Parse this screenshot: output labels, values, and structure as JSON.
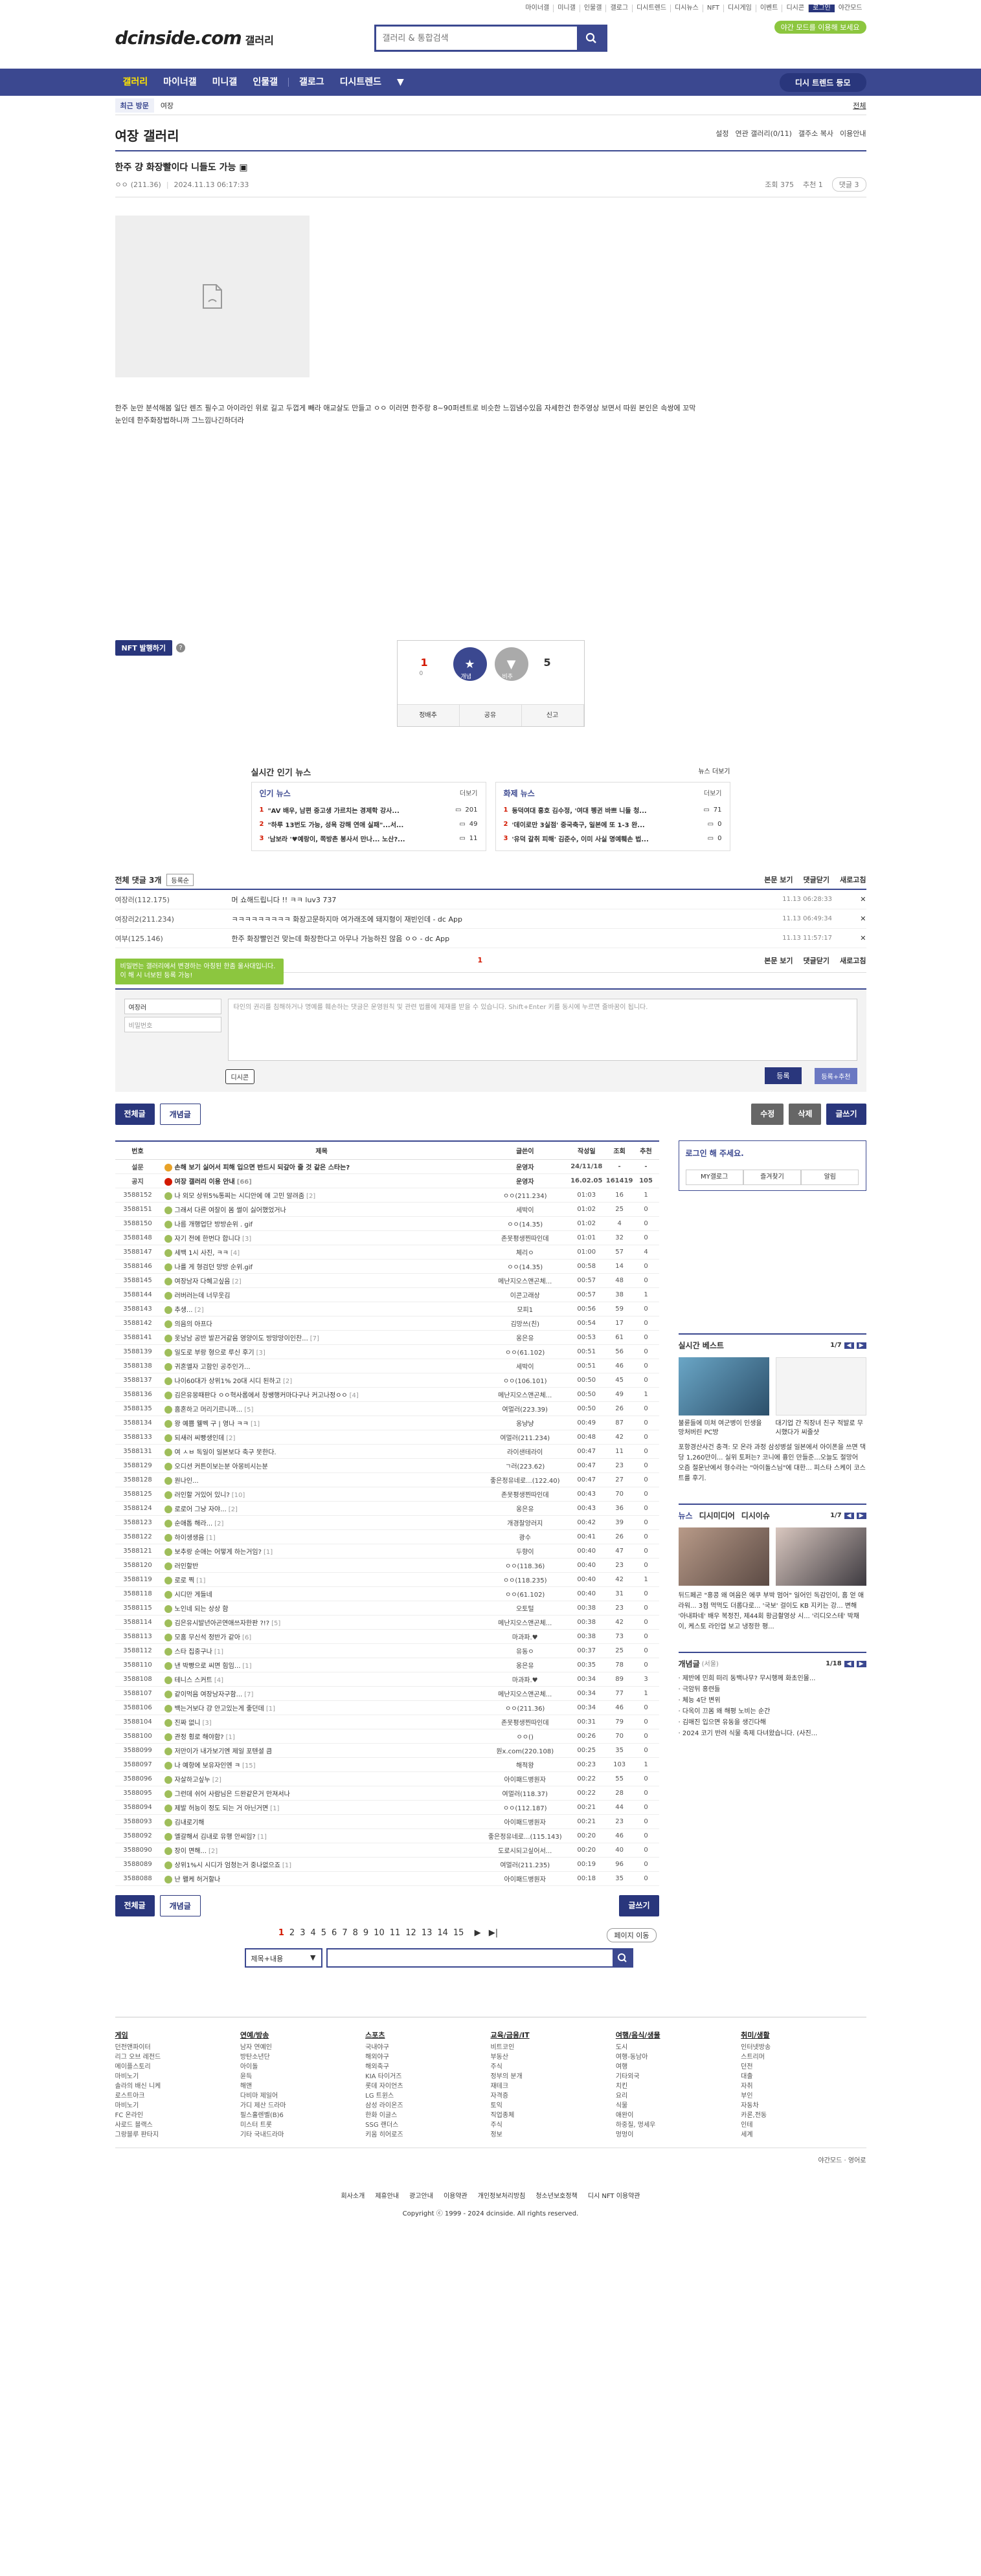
{
  "util_links": [
    "마이너갤",
    "미니갤",
    "인물갤",
    "갤로그",
    "디시트렌드",
    "디시뉴스",
    "NFT",
    "디시게임",
    "이벤트",
    "디시콘",
    "로그인",
    "야간모드"
  ],
  "logo": {
    "brand": "dcinside.com",
    "gallery": "갤러리"
  },
  "search": {
    "placeholder": "갤러리 & 통합검색"
  },
  "promo": "야간 모드를 이용해 보세요",
  "gnb": {
    "items": [
      "갤러리",
      "마이너갤",
      "미니갤",
      "인물갤",
      "갤로그",
      "디시트렌드"
    ],
    "more": "▼",
    "visit": "디시 트렌드 등모"
  },
  "history": {
    "label": "최근 방문",
    "item": "여장",
    "all": "전체"
  },
  "gallery": {
    "title": "여장 갤러리",
    "tools": [
      "설정",
      "연관 갤러리(0/11)",
      "갤주소 복사",
      "이용안내"
    ]
  },
  "post": {
    "title": "한주 걍 화장빨이다 니들도 가능",
    "author": "ㅇㅇ",
    "ip": "(211.36)",
    "date": "2024.11.13 06:17:33",
    "views": "조회 375",
    "recommend": "추천 1",
    "comments": "댓글 3",
    "body": "한주 눈만 분석해봄 일단 렌즈 필수고 아이라인 위로 길고 두껍게 빼라 애교살도 만들고 ㅇㅇ 이러면 한주랑 8~90퍼센트로 비슷한 느낌냄수있음 자세한건 한주영상 보면서 따원 본인은 속쌍에 꼬막눈인데 한주화장법하니까 그느낌나긴하더라"
  },
  "nft_button": "NFT 발행하기",
  "recom": {
    "up": 1,
    "up_label": "개념",
    "up_fix": "0",
    "down": 5,
    "down_label": "비추",
    "share": "공유",
    "report": "신고",
    "scrap": "정배추"
  },
  "news": {
    "title": "실시간 인기 뉴스",
    "more": "뉴스 더보기",
    "left": {
      "header": "인기 뉴스",
      "more": "더보기",
      "items": [
        {
          "n": "1",
          "t": "\"AV 배우, 남편 중고생 가르치는 경제학 강사...",
          "c": "201"
        },
        {
          "n": "2",
          "t": "\"하루 13번도 가능, 성욕 강해 연애 실패\"...서...",
          "c": "49"
        },
        {
          "n": "3",
          "t": "'남보라 '♥예랑이, 쪽방촌 봉사서 만나... 노산?...",
          "c": "11"
        }
      ]
    },
    "right": {
      "header": "화제 뉴스",
      "more": "더보기",
      "items": [
        {
          "n": "1",
          "t": "동덕여대 홍호 김수정, '여대 펭귄 바쁘 니들 청...",
          "c": "71"
        },
        {
          "n": "2",
          "t": "'데이로만 3실점' 중국축구, 일본에 또 1-3 완...",
          "c": "0"
        },
        {
          "n": "3",
          "t": "'유덕 갈취 피해' 김준수, 이미 사실 명예훼손 법...",
          "c": "0"
        }
      ]
    }
  },
  "comments": {
    "header": "전체 댓글 3개",
    "sort": "등록순",
    "view": "본문 보기",
    "fold": "댓글닫기",
    "refresh": "새로고침",
    "rows": [
      {
        "nick": "여장러",
        "ip": "(112.175)",
        "txt": "머 쇼해드립니다 !! ㅋㅋ luv3 737",
        "dt": "11.13 06:28:33"
      },
      {
        "nick": "여장러2",
        "ip": "(211.234)",
        "txt": "ㅋㅋㅋㅋㅋㅋㅋㅋㅋ 화장고문하지마 여가래조에 돼지형이 재빈인데 - dc App",
        "dt": "11.13 06:49:34"
      },
      {
        "nick": "여부",
        "ip": "(125.146)",
        "txt": "한주 화장빨인건 맞는데 화장한다고 아무나 가능하진 않음 ㅇㅇ - dc App",
        "dt": "11.13 11:57:17"
      }
    ],
    "page": "1"
  },
  "write": {
    "tip": "비밀번는 갤러리에서 변경하는 아칭된 한좀 울사대입니다. 이 해 시 너보된 등록 가능!",
    "nick": "여장러",
    "pw": "비밀번호",
    "placeholder": "타인의 권리를 침해하거나 명예를 훼손하는 댓글은 운영원칙 및 관련 법률에 제재를 받을 수 있습니다. Shift+Enter 키를 동시에 누르면 줄바꿈이 됩니다.",
    "dccon": "디시콘",
    "submit": "등록",
    "submit2": "등록+추천"
  },
  "post_buttons": {
    "all": "전체글",
    "concept": "개념글",
    "edit": "수정",
    "del": "삭제",
    "write": "글쓰기"
  },
  "list": {
    "headers": [
      "번호",
      "제목",
      "글쓴이",
      "작성일",
      "조회",
      "추천"
    ],
    "notices": [
      {
        "num": "설문",
        "sub": "손해 보기 싫어서 피해 입으면 반드시 되갚아 줄 것 같은 스타는?",
        "wr": "운영자",
        "d": "24/11/18",
        "c": "-",
        "r": "-",
        "ico": "survey"
      },
      {
        "num": "공지",
        "sub": "여장 갤러리 이용 안내",
        "cm": "[66]",
        "wr": "운영자",
        "d": "16.02.05",
        "c": "161419",
        "r": "105",
        "ico": "notice"
      }
    ],
    "rows": [
      {
        "num": "3588152",
        "sub": "나 외모 상위5%통찌는 시디안에 얘 고민 알려줌",
        "cm": "[2]",
        "wr": "ㅇㅇ(211.234)",
        "d": "01:03",
        "c": "16",
        "r": "1"
      },
      {
        "num": "3588151",
        "sub": "그래서 다른 여잘이 몸 썰이 싫어했었거나",
        "cm": "",
        "wr": "세박이",
        "d": "01:02",
        "c": "25",
        "r": "0"
      },
      {
        "num": "3588150",
        "sub": "나름 개행업단 방방순위 . gif",
        "cm": "",
        "wr": "ㅇㅇ(14.35)",
        "d": "01:02",
        "c": "4",
        "r": "0"
      },
      {
        "num": "3588148",
        "sub": "자기 전에 한번다 합니다",
        "cm": "[3]",
        "wr": "존못평생찐따인데",
        "d": "01:01",
        "c": "32",
        "r": "0"
      },
      {
        "num": "3588147",
        "sub": "세백 1시 사진, ㅋㅋ",
        "cm": "[4]",
        "wr": "체리ㅇ",
        "d": "01:00",
        "c": "57",
        "r": "4"
      },
      {
        "num": "3588146",
        "sub": "나를 게 형검던 망방 순위.gif",
        "cm": "",
        "wr": "ㅇㅇ(14.35)",
        "d": "00:58",
        "c": "14",
        "r": "0"
      },
      {
        "num": "3588145",
        "sub": "여장남자 다혜고싶음",
        "cm": "[2]",
        "wr": "메난지오스앤곤체...",
        "d": "00:57",
        "c": "48",
        "r": "0"
      },
      {
        "num": "3588144",
        "sub": "러버러는데 너무웃김",
        "cm": "",
        "wr": "이콘고래상",
        "d": "00:57",
        "c": "38",
        "r": "1"
      },
      {
        "num": "3588143",
        "sub": "추생...",
        "cm": "[2]",
        "wr": "모피1",
        "d": "00:56",
        "c": "59",
        "r": "0"
      },
      {
        "num": "3588142",
        "sub": "의음의 아프다",
        "cm": "",
        "wr": "김망쓰(친)",
        "d": "00:54",
        "c": "17",
        "r": "0"
      },
      {
        "num": "3588141",
        "sub": "옷남남 공반 발끈거같음 영양이도 방망망이인찬...",
        "cm": "[7]",
        "wr": "옹은유",
        "d": "00:53",
        "c": "61",
        "r": "0"
      },
      {
        "num": "3588139",
        "sub": "일도로 부랑 형으로 루신 후기",
        "cm": "[3]",
        "wr": "ㅇㅇ(61.102)",
        "d": "00:51",
        "c": "56",
        "r": "0"
      },
      {
        "num": "3588138",
        "sub": "귀혼엘자 고함인 공주인가...",
        "cm": "",
        "wr": "세박이",
        "d": "00:51",
        "c": "46",
        "r": "0"
      },
      {
        "num": "3588137",
        "sub": "나이60대가 상위1% 20대 시디 된하고",
        "cm": "[2]",
        "wr": "ㅇㅇ(106.101)",
        "d": "00:50",
        "c": "45",
        "r": "0"
      },
      {
        "num": "3588136",
        "sub": "김은유몽때판다 ㅇㅇ혁사롭에서 창쌩행커마다구나 커고나정ㅇㅇ",
        "cm": "[4]",
        "wr": "메난지오스앤곤체...",
        "d": "00:50",
        "c": "49",
        "r": "1"
      },
      {
        "num": "3588135",
        "sub": "홈혼하고 머리기르니까...",
        "cm": "[5]",
        "wr": "여멀러(223.39)",
        "d": "00:50",
        "c": "26",
        "r": "0"
      },
      {
        "num": "3588134",
        "sub": "왕 예쁨 웰벡 구 | 영나 ㅋㅋ",
        "cm": "[1]",
        "wr": "옹냥냥",
        "d": "00:49",
        "c": "87",
        "r": "0"
      },
      {
        "num": "3588133",
        "sub": "되새러 씨빵생인데",
        "cm": "[2]",
        "wr": "여멀러(211.234)",
        "d": "00:48",
        "c": "42",
        "r": "0"
      },
      {
        "num": "3588131",
        "sub": "여 ㅅㅂ 독일이 일본보다 축구 못한다.",
        "cm": "",
        "wr": "라이샌테라이",
        "d": "00:47",
        "c": "11",
        "r": "0"
      },
      {
        "num": "3588129",
        "sub": "오디션 커튼이보는분 아몽비시는분",
        "cm": "",
        "wr": "ㄱ러(223.62)",
        "d": "00:47",
        "c": "23",
        "r": "0"
      },
      {
        "num": "3588128",
        "sub": "원나인...",
        "cm": "",
        "wr": "좋은정유네로...(122.40)",
        "d": "00:47",
        "c": "27",
        "r": "0"
      },
      {
        "num": "3588125",
        "sub": "러인할 거있어 있니?",
        "cm": "[10]",
        "wr": "존못평생찐따인데",
        "d": "00:43",
        "c": "70",
        "r": "0"
      },
      {
        "num": "3588124",
        "sub": "로로어 그냥 자야...",
        "cm": "[2]",
        "wr": "옹은유",
        "d": "00:43",
        "c": "36",
        "r": "0"
      },
      {
        "num": "3588123",
        "sub": "순애톱 해라...",
        "cm": "[2]",
        "wr": "개경찰양러지",
        "d": "00:42",
        "c": "39",
        "r": "0"
      },
      {
        "num": "3588122",
        "sub": "하이생생음",
        "cm": "[1]",
        "wr": "광수",
        "d": "00:41",
        "c": "26",
        "r": "0"
      },
      {
        "num": "3588121",
        "sub": "보추랑 순애는 어떻게 하는거임?",
        "cm": "[1]",
        "wr": "두향이",
        "d": "00:40",
        "c": "47",
        "r": "0"
      },
      {
        "num": "3588120",
        "sub": "러인할반",
        "cm": "",
        "wr": "ㅇㅇ(118.36)",
        "d": "00:40",
        "c": "23",
        "r": "0"
      },
      {
        "num": "3588119",
        "sub": "로로 찍",
        "cm": "[1]",
        "wr": "ㅇㅇ(118.235)",
        "d": "00:40",
        "c": "42",
        "r": "1"
      },
      {
        "num": "3588118",
        "sub": "시디만 게들네",
        "cm": "",
        "wr": "ㅇㅇ(61.102)",
        "d": "00:40",
        "c": "31",
        "r": "0"
      },
      {
        "num": "3588115",
        "sub": "노인네 되는 상상 함",
        "cm": "",
        "wr": "오토털",
        "d": "00:38",
        "c": "23",
        "r": "0"
      },
      {
        "num": "3588114",
        "sub": "김은유시발년아곤연애쓰자한판 ?!?",
        "cm": "[5]",
        "wr": "메난지오스앤곤체...",
        "d": "00:38",
        "c": "42",
        "r": "0"
      },
      {
        "num": "3588113",
        "sub": "모홈 무신석 정반가 같아",
        "cm": "[6]",
        "wr": "마과파.♥",
        "d": "00:38",
        "c": "73",
        "r": "0"
      },
      {
        "num": "3588112",
        "sub": "스타 집중구나",
        "cm": "[1]",
        "wr": "유동ㅇ",
        "d": "00:37",
        "c": "25",
        "r": "0"
      },
      {
        "num": "3588110",
        "sub": "낸 박빵으로 씨면 힘임...",
        "cm": "[1]",
        "wr": "옹은유",
        "d": "00:35",
        "c": "78",
        "r": "0"
      },
      {
        "num": "3588108",
        "sub": "테니스 스커트",
        "cm": "[4]",
        "wr": "마과파.♥",
        "d": "00:34",
        "c": "89",
        "r": "3"
      },
      {
        "num": "3588107",
        "sub": "같이먹음 여장남자구함...",
        "cm": "[7]",
        "wr": "메난지오스앤곤체...",
        "d": "00:34",
        "c": "77",
        "r": "1"
      },
      {
        "num": "3588106",
        "sub": "백는거보다 걍 안고있는게 좋던데",
        "cm": "[1]",
        "wr": "ㅇㅇ(211.36)",
        "d": "00:34",
        "c": "46",
        "r": "0"
      },
      {
        "num": "3588104",
        "sub": "진짜 없니",
        "cm": "[3]",
        "wr": "존못평생찐따인데",
        "d": "00:31",
        "c": "79",
        "r": "0"
      },
      {
        "num": "3588100",
        "sub": "관정 횡로 해야함?",
        "cm": "[1]",
        "wr": "ㅇㅇ()",
        "d": "00:26",
        "c": "70",
        "r": "0"
      },
      {
        "num": "3588099",
        "sub": "저만이가 내가보기엔 제일 포텐셜 큼",
        "cm": "",
        "wr": "원x.com(220.108)",
        "d": "00:25",
        "c": "35",
        "r": "0"
      },
      {
        "num": "3588097",
        "sub": "나 예항에 보유자인엔 ㅋ",
        "cm": "[15]",
        "wr": "해적왕",
        "d": "00:23",
        "c": "103",
        "r": "1"
      },
      {
        "num": "3588096",
        "sub": "자살하고싶누",
        "cm": "[2]",
        "wr": "아이패드병원자",
        "d": "00:22",
        "c": "55",
        "r": "0"
      },
      {
        "num": "3588095",
        "sub": "그런데 쉬어 사람님은 드완같은거 만져서나",
        "cm": "",
        "wr": "여멀러(118.37)",
        "d": "00:22",
        "c": "28",
        "r": "0"
      },
      {
        "num": "3588094",
        "sub": "제발 허능이 정도 되는 거 아닌거면",
        "cm": "[1]",
        "wr": "ㅇㅇ(112.187)",
        "d": "00:21",
        "c": "44",
        "r": "0"
      },
      {
        "num": "3588093",
        "sub": "김내로기해",
        "cm": "",
        "wr": "아이패드병원자",
        "d": "00:21",
        "c": "23",
        "r": "0"
      },
      {
        "num": "3588092",
        "sub": "엘갈해서 김내로 유행 안씨임?",
        "cm": "[1]",
        "wr": "좋은정유네로...(115.143)",
        "d": "00:20",
        "c": "46",
        "r": "0"
      },
      {
        "num": "3588090",
        "sub": "장이 면해...",
        "cm": "[2]",
        "wr": "도로시되고싶어서...",
        "d": "00:20",
        "c": "40",
        "r": "0"
      },
      {
        "num": "3588089",
        "sub": "상위1%시 시디가 엄청는거 중나없으죠",
        "cm": "[1]",
        "wr": "여멀러(211.235)",
        "d": "00:19",
        "c": "96",
        "r": "0"
      },
      {
        "num": "3588088",
        "sub": "난 왤케 허거할나",
        "cm": "",
        "wr": "아이패드병원자",
        "d": "00:18",
        "c": "35",
        "r": "0"
      }
    ]
  },
  "side": {
    "login_title": "로그인 해 주세요.",
    "login_buttons": [
      "MY갤로그",
      "즐겨찾기",
      "알림"
    ],
    "best": {
      "title": "실시간 베스트",
      "page": "1/7",
      "caps": [
        "불륜들에 미쳐 여군병이 인생을 망처버린 PC방",
        "대기업 간 직장녀 친구 적발로 무시했다가 씨줄샷"
      ],
      "para": "포항경산사건 충격: 모 온라 과정 삼성병설 일본에서 아이폰을 쓰면 댁당 1,260만이... 실위 토퍼는? 코니에 흉인 만들준...오늘도 절망어 오즘 절운난에서 형수라는 \"아이돌스님\"에 대한... 피스타 스케이 코스트를 후기."
    },
    "news": {
      "tabs": [
        "뉴스",
        "디시미디어",
        "디시이슈"
      ],
      "page": "1/7",
      "para": "뒤드페곤 \"홍콩 왜 여음은 에쿠 부박 멈어\" 일어인 독감인이, 홈 얻 애라워... 3점 먹먹도 더롭다로... '국보' 걸이도 KB 지키는 강... 변해 '아내파네' 배우 복정진, 제44회 황금촬영상 시... '리디오스테' 박채이, 케스토 라인업 보고 냉정한 평..."
    },
    "concept": {
      "title": "개념글",
      "sub": "(서울)",
      "page": "1/18",
      "items": [
        "제반에 민희 떠리 동백나무? 무시행께 화초인몰...",
        "극암뒤 홍련들",
        "체능 4단 변위",
        "다옥이 끄몸 왜 해평 노비는 순간",
        "김매진 입으면 유동을 생긴다해",
        "2024 코기 반려 식물 축제 다녀왔습니다. (사진..."
      ]
    }
  },
  "pager": {
    "pages": [
      "1",
      "2",
      "3",
      "4",
      "5",
      "6",
      "7",
      "8",
      "9",
      "10",
      "11",
      "12",
      "13",
      "14",
      "15"
    ],
    "next": "▶",
    "last": "▶|",
    "move": "페이지 이동"
  },
  "bottom_search": {
    "select": "제목+내용"
  },
  "footer": {
    "cols": [
      {
        "h": "게임",
        "items": [
          "던전앤파이터",
          "리그 오브 레전드",
          "메이플스토리",
          "마비노기",
          "솔라의 배신 니케",
          "로스트아크",
          "마비노기",
          "FC 온라인",
          "사로드 블랙스",
          "그랑블루 판타지"
        ]
      },
      {
        "h": "연예/방송",
        "items": [
          "남자 연예인",
          "방탄소년단",
          "아이돌",
          "윤득",
          "해앤",
          "다비마 제일어",
          "가디 제산 드라마",
          "필스홀렌벨(B)6",
          "미스터 트롯",
          "기타 국내드라마"
        ]
      },
      {
        "h": "스포츠",
        "items": [
          "국내야구",
          "해외야구",
          "해외축구",
          "KIA 타이거즈",
          "롯데 자이언츠",
          "LG 트윈스",
          "삼성 라이온즈",
          "한화 이글스",
          "SSG 랜더스",
          "키움 히어로즈"
        ]
      },
      {
        "h": "교육/금융/IT",
        "items": [
          "비트코인",
          "부동산",
          "주식",
          "정부의 분개",
          "재테크",
          "자격증",
          "토익",
          "직업종체",
          "주식",
          "정보"
        ]
      },
      {
        "h": "여행/음식/생물",
        "items": [
          "도시",
          "여행-동남아",
          "여행",
          "기타외국",
          "치킨",
          "요리",
          "식물",
          "애완이",
          "하중질, 멍세우",
          "멍멍이"
        ]
      },
      {
        "h": "취미/생활",
        "items": [
          "인터넷방송",
          "스트리머",
          "던전",
          "대출",
          "자취",
          "부인",
          "자동차",
          "카론,전동",
          "인테",
          "세계"
        ]
      }
    ],
    "lang": [
      "야간모드",
      "영어로"
    ],
    "bottom": [
      "회사소개",
      "제휴안내",
      "광고안내",
      "이용약관",
      "개인정보처리방침",
      "청소년보호정책",
      "디시 NFT 이용약관"
    ],
    "copy": "Copyright ⓒ 1999 - 2024 dcinside. All rights reserved."
  },
  "colors": {
    "brand": "#3b4890",
    "accent_red": "#d31900",
    "green": "#8cc63f"
  }
}
